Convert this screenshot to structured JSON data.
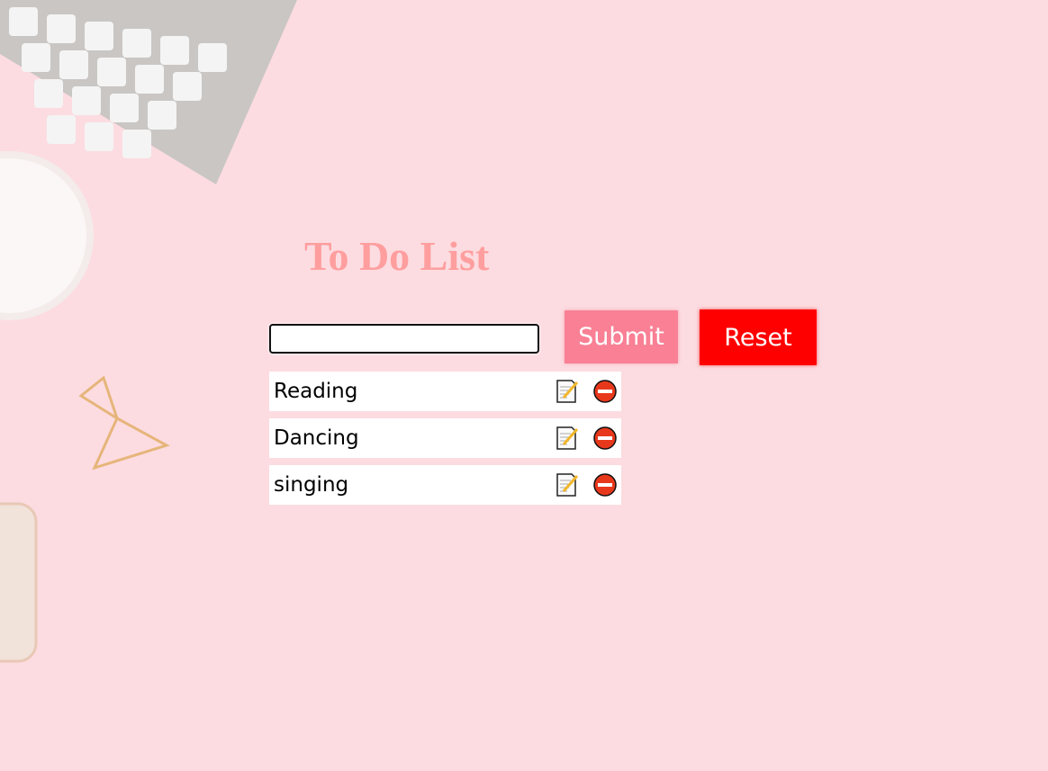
{
  "header": {
    "title": "To Do List"
  },
  "form": {
    "input_value": "",
    "submit_label": "Submit",
    "reset_label": "Reset"
  },
  "todos": [
    {
      "text": "Reading"
    },
    {
      "text": "Dancing"
    },
    {
      "text": "singing"
    }
  ],
  "icons": {
    "edit": "edit-note-icon",
    "delete": "delete-minus-circle-icon"
  },
  "colors": {
    "background": "#fcdce1",
    "title": "#ff9e9e",
    "submit": "#f98095",
    "reset": "#fe0000"
  }
}
